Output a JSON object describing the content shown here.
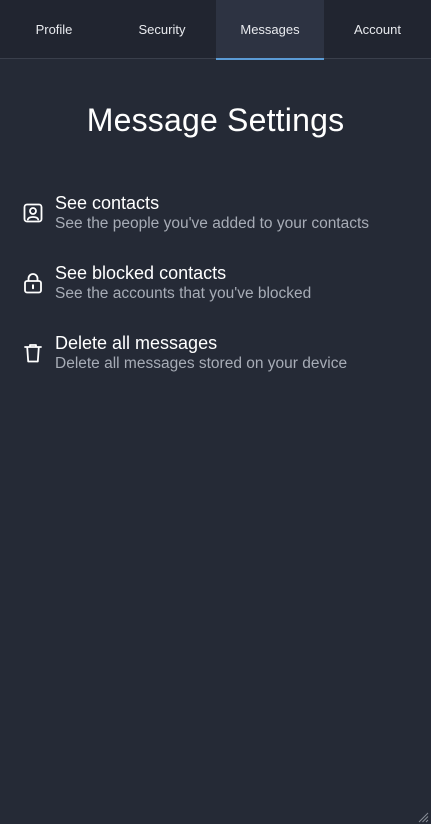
{
  "tabs": [
    {
      "label": "Profile",
      "active": false
    },
    {
      "label": "Security",
      "active": false
    },
    {
      "label": "Messages",
      "active": true
    },
    {
      "label": "Account",
      "active": false
    }
  ],
  "page": {
    "title": "Message Settings"
  },
  "items": [
    {
      "icon": "contact-card-icon",
      "title": "See contacts",
      "description": "See the people you've added to your contacts"
    },
    {
      "icon": "lock-icon",
      "title": "See blocked contacts",
      "description": "See the accounts that you've blocked"
    },
    {
      "icon": "trash-icon",
      "title": "Delete all messages",
      "description": "Delete all messages stored on your device"
    }
  ],
  "colors": {
    "background": "#252a36",
    "tab_active_underline": "#5b9bd5",
    "text_primary": "#ffffff",
    "text_secondary": "#a7acb6"
  }
}
